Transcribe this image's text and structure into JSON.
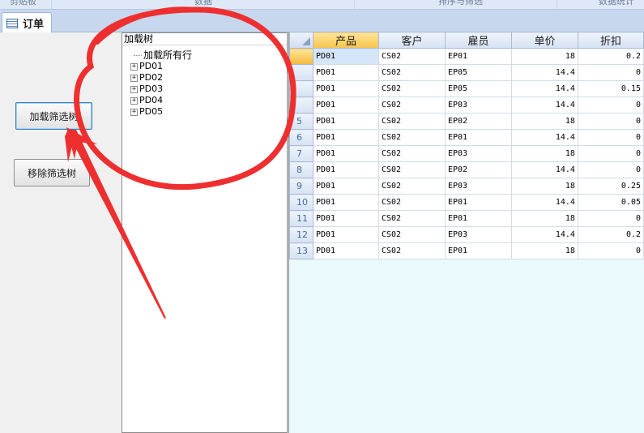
{
  "ribbon": {
    "groups": [
      "剪贴板",
      "数据",
      "排序与筛选",
      "数据统计"
    ]
  },
  "tab": {
    "label": "订单",
    "icon": "datasheet-icon"
  },
  "buttons": {
    "load_label": "加载筛选树",
    "remove_label": "移除筛选树"
  },
  "tree": {
    "title": "加载树",
    "root_label": "加载所有行",
    "nodes": [
      "PD01",
      "PD02",
      "PD03",
      "PD04",
      "PD05"
    ]
  },
  "grid": {
    "headers": [
      "产品",
      "客户",
      "雇员",
      "单价",
      "折扣"
    ],
    "rows": [
      {
        "num": "",
        "product": "PD01",
        "customer": "CS02",
        "employee": "EP01",
        "price": "18",
        "discount": "0.2"
      },
      {
        "num": "",
        "product": "PD01",
        "customer": "CS02",
        "employee": "EP05",
        "price": "14.4",
        "discount": "0"
      },
      {
        "num": "",
        "product": "PD01",
        "customer": "CS02",
        "employee": "EP05",
        "price": "14.4",
        "discount": "0.15"
      },
      {
        "num": "",
        "product": "PD01",
        "customer": "CS02",
        "employee": "EP03",
        "price": "14.4",
        "discount": "0"
      },
      {
        "num": "5",
        "product": "PD01",
        "customer": "CS02",
        "employee": "EP02",
        "price": "18",
        "discount": "0"
      },
      {
        "num": "6",
        "product": "PD01",
        "customer": "CS02",
        "employee": "EP01",
        "price": "14.4",
        "discount": "0"
      },
      {
        "num": "7",
        "product": "PD01",
        "customer": "CS02",
        "employee": "EP03",
        "price": "18",
        "discount": "0"
      },
      {
        "num": "8",
        "product": "PD01",
        "customer": "CS02",
        "employee": "EP02",
        "price": "14.4",
        "discount": "0"
      },
      {
        "num": "9",
        "product": "PD01",
        "customer": "CS02",
        "employee": "EP03",
        "price": "18",
        "discount": "0.25"
      },
      {
        "num": "10",
        "product": "PD01",
        "customer": "CS02",
        "employee": "EP01",
        "price": "14.4",
        "discount": "0.05"
      },
      {
        "num": "11",
        "product": "PD01",
        "customer": "CS02",
        "employee": "EP01",
        "price": "18",
        "discount": "0"
      },
      {
        "num": "12",
        "product": "PD01",
        "customer": "CS02",
        "employee": "EP03",
        "price": "14.4",
        "discount": "0.2"
      },
      {
        "num": "13",
        "product": "PD01",
        "customer": "CS02",
        "employee": "EP01",
        "price": "18",
        "discount": "0"
      }
    ]
  },
  "colors": {
    "annotation": "#ee2f2f",
    "sheet_background": "#eaf9fb"
  }
}
